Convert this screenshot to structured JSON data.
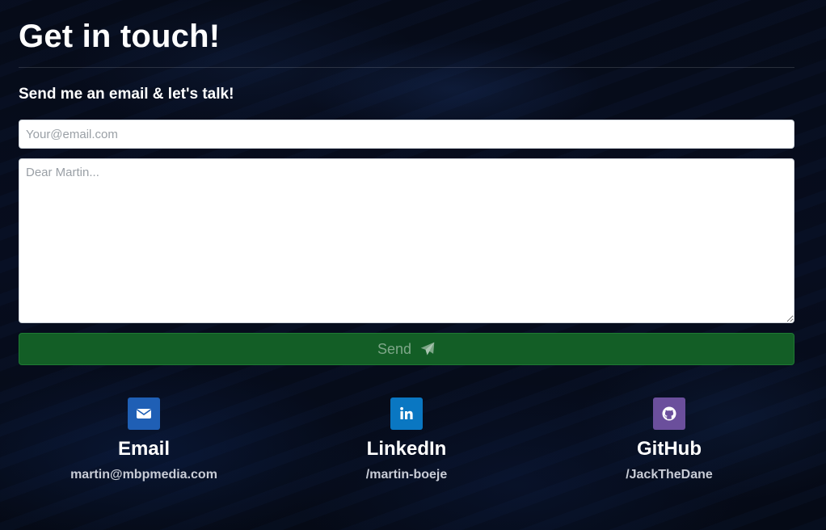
{
  "heading": {
    "title": "Get in touch!",
    "subtitle": "Send me an email & let's talk!"
  },
  "form": {
    "email_placeholder": "Your@email.com",
    "email_value": "",
    "message_placeholder": "Dear Martin...",
    "message_value": "",
    "send_label": "Send",
    "send_icon": "paper-plane-icon"
  },
  "contacts": [
    {
      "label": "Email",
      "handle": "martin@mbpmedia.com",
      "icon": "envelope-icon",
      "color": "#1f5fb5"
    },
    {
      "label": "LinkedIn",
      "handle": "/martin-boeje",
      "icon": "linkedin-icon",
      "color": "#0a77c2"
    },
    {
      "label": "GitHub",
      "handle": "/JackTheDane",
      "icon": "github-icon",
      "color": "#6b4f9c"
    }
  ],
  "colors": {
    "background": "#060b1a",
    "send_button": "#135e26",
    "divider": "rgba(255,255,255,0.14)"
  }
}
